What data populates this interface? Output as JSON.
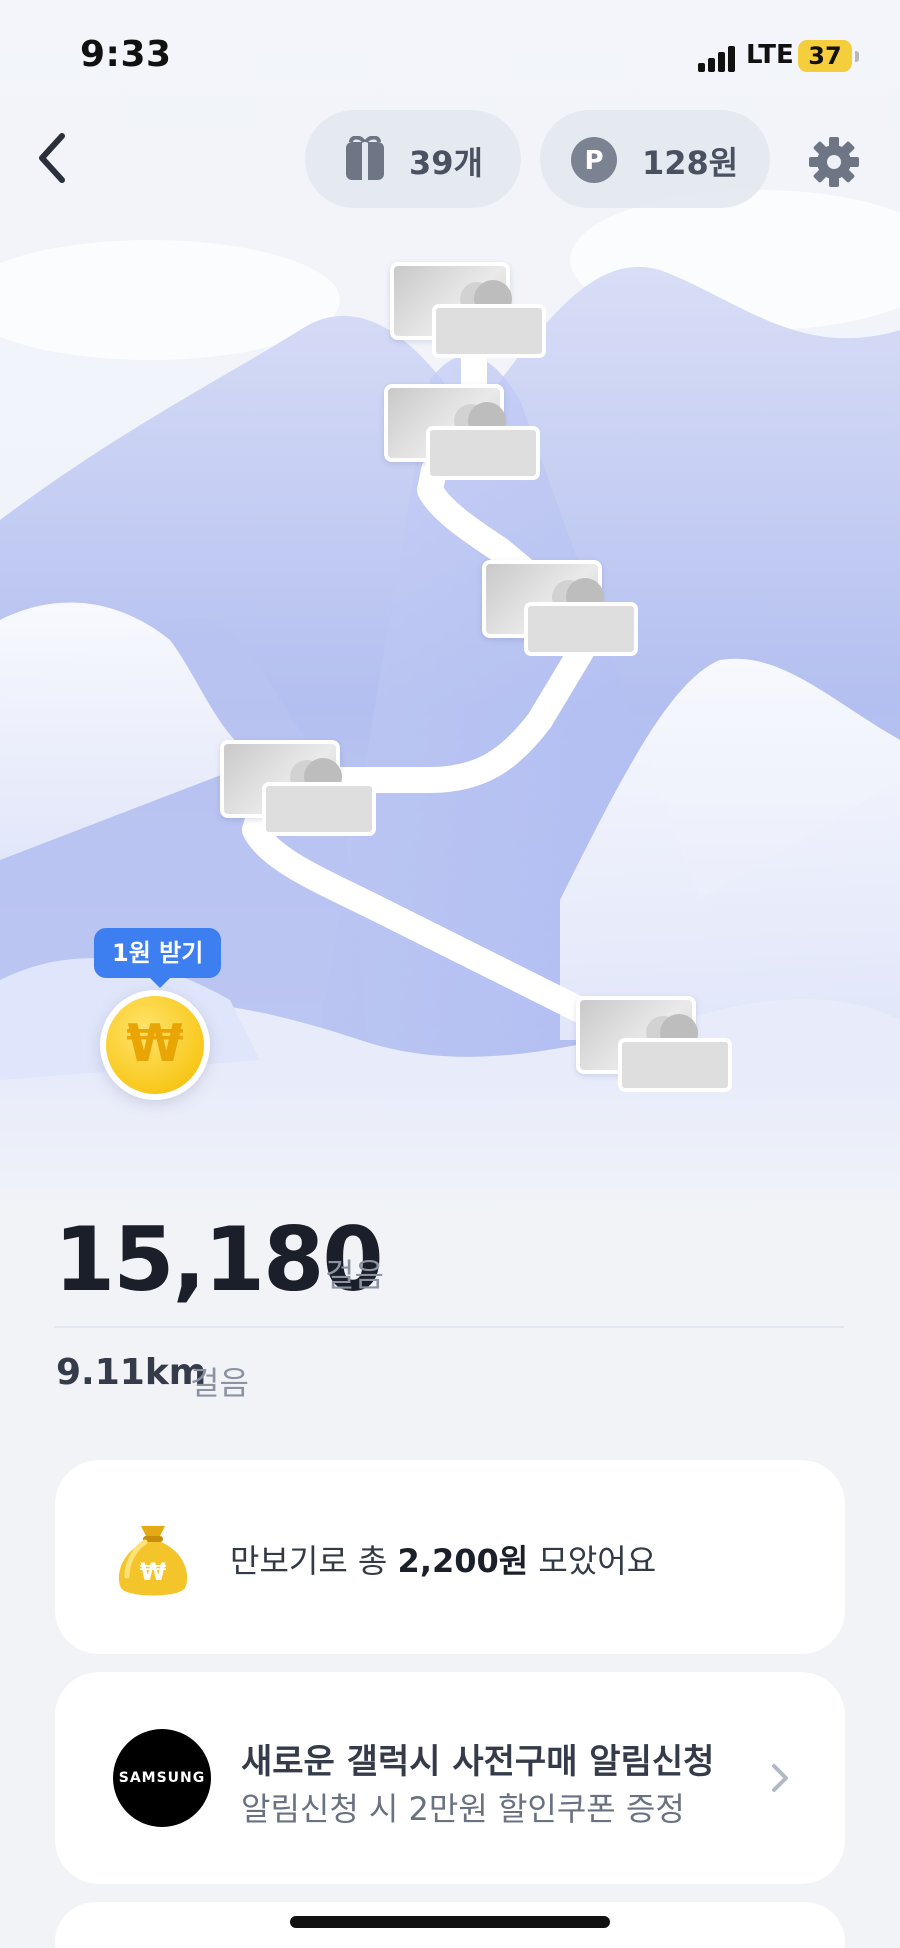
{
  "status_bar": {
    "time": "9:33",
    "network": "LTE",
    "battery": "37"
  },
  "header": {
    "back_icon": "chevron-left-icon",
    "gift_count": "39개",
    "gift_icon": "gift-icon",
    "points": "128원",
    "points_icon": "p-coin-icon",
    "settings_icon": "gear-icon"
  },
  "map": {
    "stage_count": 5,
    "reward_badge": "1원 받기",
    "coin_symbol": "₩"
  },
  "steps": {
    "count": "15,180",
    "unit": "걸음",
    "distance": "9.11km",
    "distance_unit": "걸음"
  },
  "total_card": {
    "icon": "money-bag-icon",
    "prefix": "만보기로 총 ",
    "amount": "2,200원",
    "suffix": " 모았어요"
  },
  "ad_card": {
    "logo_text": "SAMSUNG",
    "title": "새로운 갤럭시 사전구매 알림신청",
    "subtitle": "알림신청 시 2만원 할인쿠폰 증정",
    "chevron_icon": "chevron-right-icon"
  },
  "colors": {
    "accent": "#3d7ff0",
    "coin": "#f8c81c",
    "mountain": "#aab8f2"
  }
}
